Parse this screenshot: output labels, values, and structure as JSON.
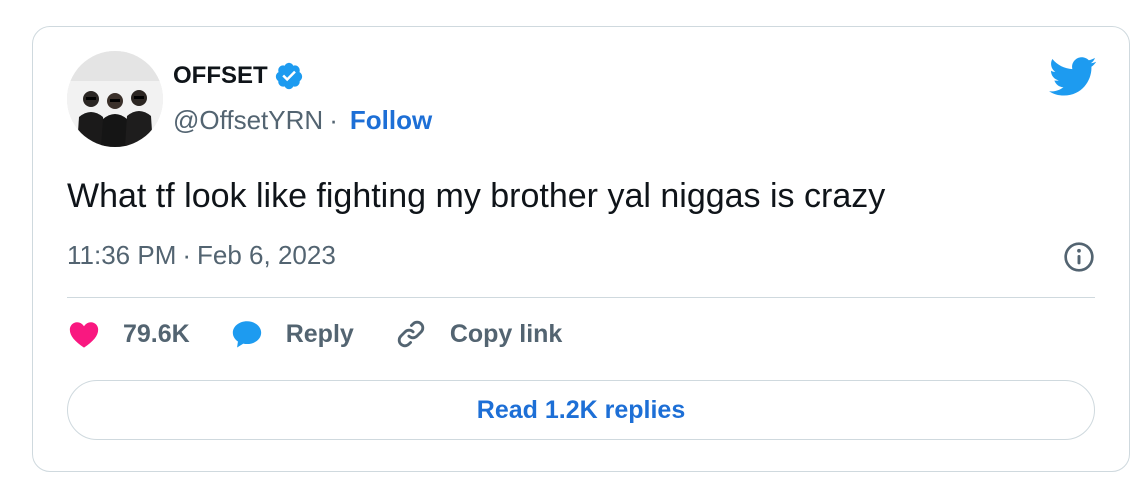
{
  "user": {
    "name": "OFFSET",
    "handle": "@OffsetYRN",
    "separator": "·",
    "follow_label": "Follow"
  },
  "tweet": {
    "text": "What tf look like fighting my brother yal niggas is crazy",
    "time": "11:36 PM",
    "separator": "·",
    "date": "Feb 6, 2023"
  },
  "actions": {
    "likes": "79.6K",
    "reply_label": "Reply",
    "copy_label": "Copy link"
  },
  "replies_button": "Read 1.2K replies",
  "colors": {
    "accent": "#1d6fd6",
    "twitter_blue": "#1d9bf0",
    "like_pink": "#f91880",
    "muted": "#536471",
    "border": "#cfd9de"
  },
  "icons": [
    "verified-badge-icon",
    "twitter-bird-icon",
    "info-icon",
    "heart-icon",
    "reply-bubble-icon",
    "link-icon"
  ]
}
